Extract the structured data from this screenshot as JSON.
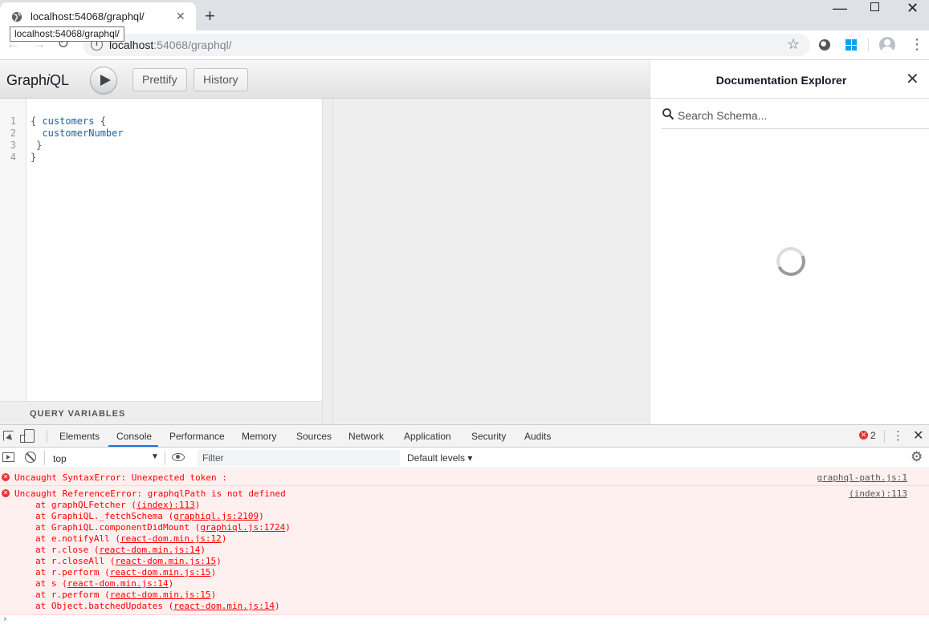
{
  "browser": {
    "tab_title": "localhost:54068/graphql/",
    "tooltip": "localhost:54068/graphql/",
    "url_host": "localhost",
    "url_rest": ":54068/graphql/"
  },
  "graphiql": {
    "title_prefix": "Graph",
    "title_i": "i",
    "title_suffix": "QL",
    "prettify_label": "Prettify",
    "history_label": "History",
    "query_lines": [
      {
        "num": "1",
        "open": "{ ",
        "field": "customers",
        "close": " {"
      },
      {
        "num": "2",
        "open": "  ",
        "field": "customerNumber",
        "close": ""
      },
      {
        "num": "3",
        "open": " }",
        "field": "",
        "close": ""
      },
      {
        "num": "4",
        "open": "}",
        "field": "",
        "close": ""
      }
    ],
    "query_variables_label": "QUERY VARIABLES"
  },
  "docs": {
    "title": "Documentation Explorer",
    "search_placeholder": "Search Schema..."
  },
  "devtools": {
    "tabs": [
      "Elements",
      "Console",
      "Performance",
      "Memory",
      "Sources",
      "Network",
      "Application",
      "Security",
      "Audits"
    ],
    "active_tab": "Console",
    "error_count": "2",
    "context": "top",
    "filter_placeholder": "Filter",
    "levels_label": "Default levels ▾",
    "messages": [
      {
        "text": "Uncaught SyntaxError: Unexpected token :",
        "source": "graphql-path.js:1"
      },
      {
        "text": "Uncaught ReferenceError: graphqlPath is not defined",
        "source": "(index):113",
        "stack": [
          {
            "fn": "at graphQLFetcher (",
            "loc": "(index):113",
            "end": ")"
          },
          {
            "fn": "at GraphiQL._fetchSchema (",
            "loc": "graphiql.js:2109",
            "end": ")"
          },
          {
            "fn": "at GraphiQL.componentDidMount (",
            "loc": "graphiql.js:1724",
            "end": ")"
          },
          {
            "fn": "at e.notifyAll (",
            "loc": "react-dom.min.js:12",
            "end": ")"
          },
          {
            "fn": "at r.close (",
            "loc": "react-dom.min.js:14",
            "end": ")"
          },
          {
            "fn": "at r.closeAll (",
            "loc": "react-dom.min.js:15",
            "end": ")"
          },
          {
            "fn": "at r.perform (",
            "loc": "react-dom.min.js:15",
            "end": ")"
          },
          {
            "fn": "at s (",
            "loc": "react-dom.min.js:14",
            "end": ")"
          },
          {
            "fn": "at r.perform (",
            "loc": "react-dom.min.js:15",
            "end": ")"
          },
          {
            "fn": "at Object.batchedUpdates (",
            "loc": "react-dom.min.js:14",
            "end": ")"
          }
        ]
      }
    ]
  }
}
